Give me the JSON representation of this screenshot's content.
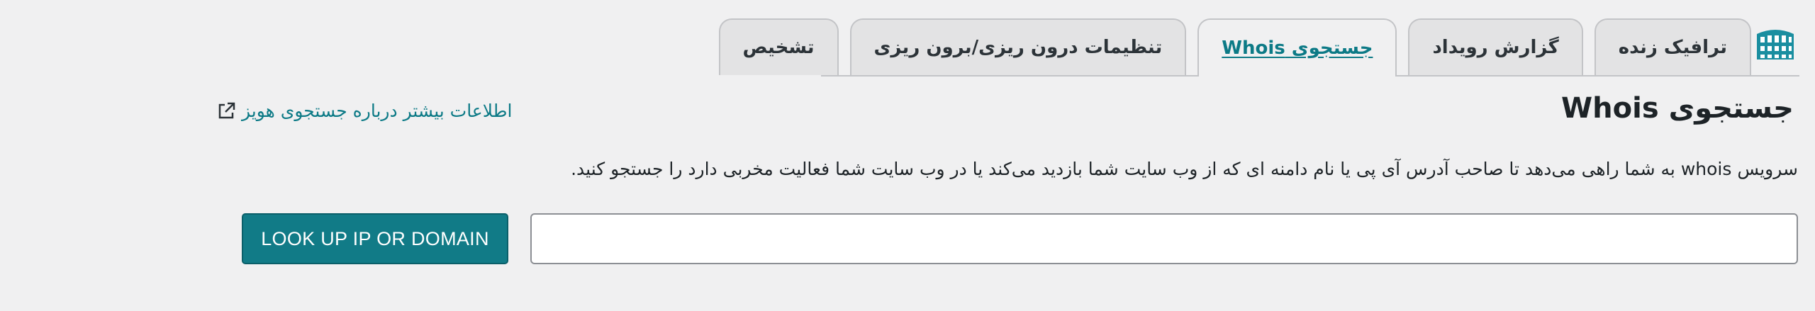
{
  "tabs": [
    {
      "label": "ترافیک زنده",
      "active": false
    },
    {
      "label": "گزارش رویداد",
      "active": false
    },
    {
      "label": "جستجوی Whois",
      "active": true
    },
    {
      "label": "تنظیمات درون ریزی/برون ریزی",
      "active": false
    },
    {
      "label": "تشخیص",
      "active": false
    }
  ],
  "logo_icon": "wordfence-logo-icon",
  "page": {
    "title": "جستجوی Whois",
    "learn_more_link": "اطلاعات بیشتر درباره جستجوی هویز",
    "learn_more_icon": "external-link-icon",
    "description": "سرویس whois به شما راهی می‌دهد تا صاحب آدرس آی پی یا نام دامنه ای که از وب سایت شما بازدید می‌کند یا در وب سایت شما فعالیت مخربی دارد را جستجو کنید."
  },
  "form": {
    "input_value": "",
    "input_placeholder": "",
    "button_label": "LOOK UP IP OR DOMAIN"
  },
  "colors": {
    "accent": "#117b87",
    "link": "#0c7a86",
    "background": "#f0f0f1"
  }
}
